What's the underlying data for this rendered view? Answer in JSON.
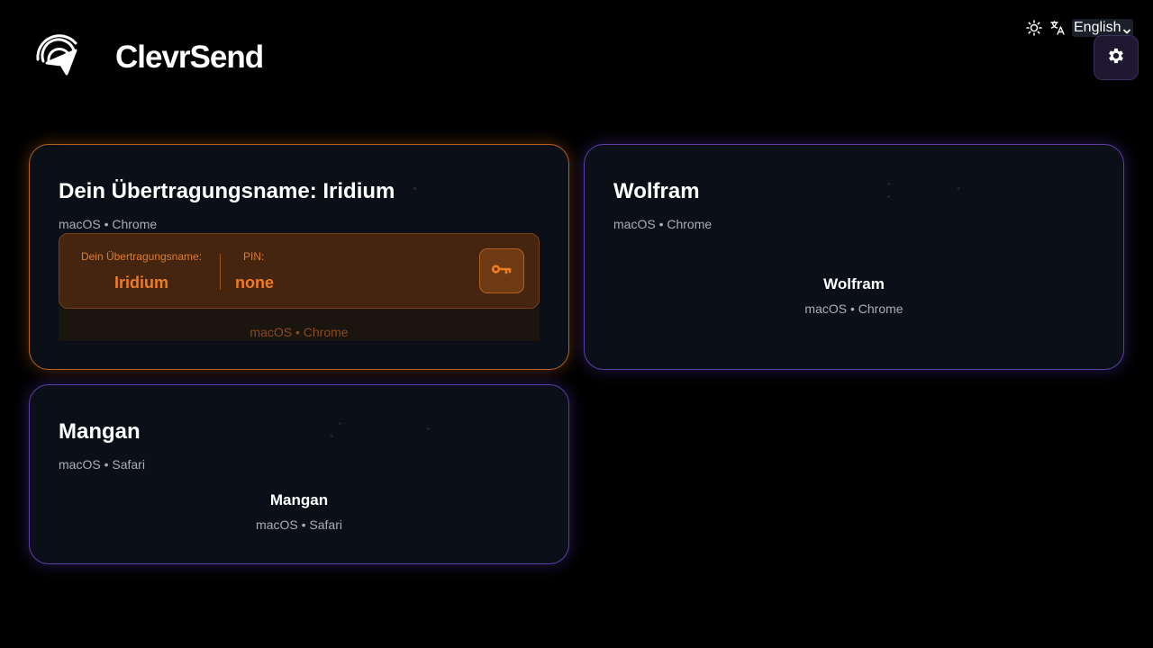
{
  "app": {
    "title": "ClevrSend",
    "logo_icon": "paper-plane-wifi-icon"
  },
  "topbar": {
    "theme_icon": "sun-icon",
    "language_icon": "translate-icon",
    "language": "English",
    "settings_icon": "gear-icon"
  },
  "colors": {
    "accent_self": "#f07c22",
    "accent_peer": "#6a4fd0",
    "card_bg": "#0b0f18"
  },
  "self_card": {
    "title": "Dein Übertragungsname: Iridium",
    "subtitle": "macOS • Chrome",
    "name_label": "Dein Übertragungsname:",
    "name_value": "Iridium",
    "pin_label": "PIN:",
    "pin_value": "none",
    "key_icon": "key-icon",
    "footer": "macOS • Chrome"
  },
  "peers": [
    {
      "title": "Wolfram",
      "subtitle": "macOS • Chrome",
      "center_name": "Wolfram",
      "center_sub": "macOS • Chrome"
    },
    {
      "title": "Mangan",
      "subtitle": "macOS • Safari",
      "center_name": "Mangan",
      "center_sub": "macOS • Safari"
    }
  ]
}
